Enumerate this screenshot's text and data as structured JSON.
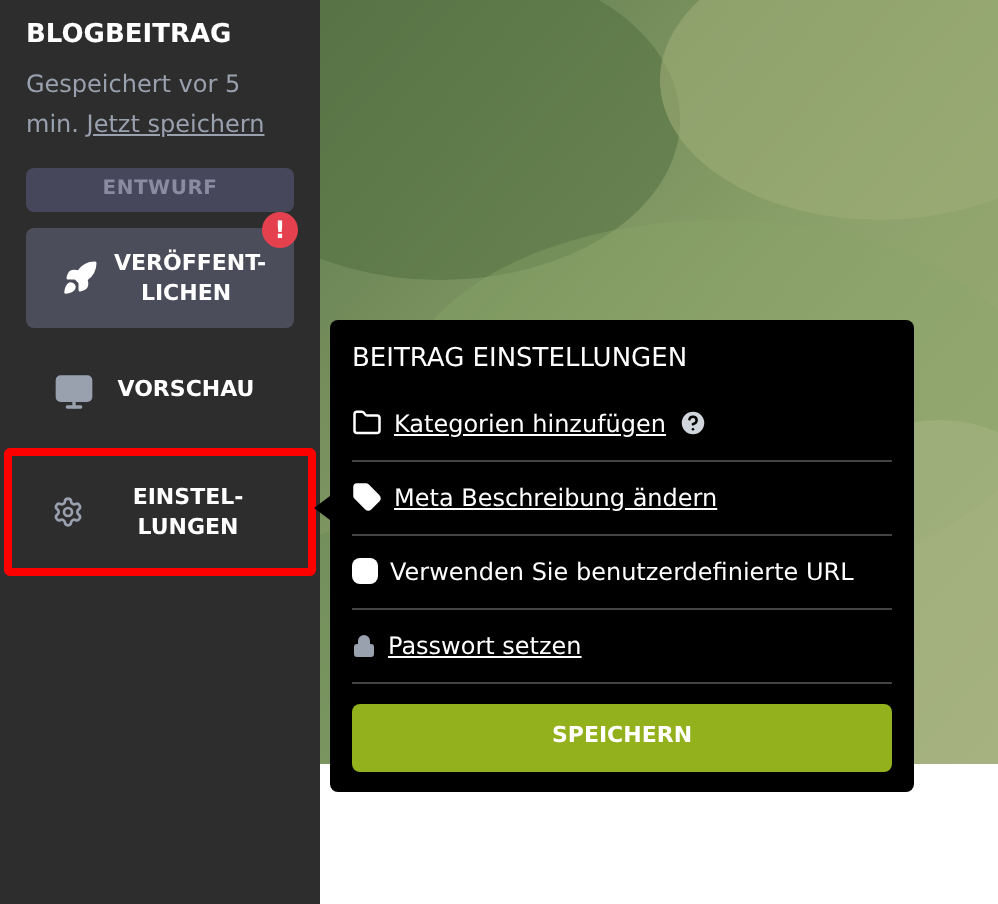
{
  "sidebar": {
    "title": "BLOGBEITRAG",
    "saved_text": "Gespeichert vor 5 min.",
    "save_link": "Jetzt speichern",
    "status": "ENTWURF",
    "publish": {
      "label": "VERÖFFENT-LICHEN",
      "alert": "!"
    },
    "items": [
      {
        "kind": "preview",
        "label": "VORSCHAU",
        "highlighted": false
      },
      {
        "kind": "settings",
        "label": "EINSTEL-LUNGEN",
        "highlighted": true
      }
    ]
  },
  "popup": {
    "title": "BEITRAG EINSTELLUNGEN",
    "options": [
      {
        "kind": "categories",
        "label": "Kategorien hinzufügen"
      },
      {
        "kind": "meta",
        "label": "Meta Beschreibung ändern"
      },
      {
        "kind": "checkbox",
        "label": "Verwenden Sie benutzerdefinierte URL",
        "checked": false
      },
      {
        "kind": "password",
        "label": "Passwort setzen"
      }
    ],
    "button": "SPEICHERN"
  }
}
